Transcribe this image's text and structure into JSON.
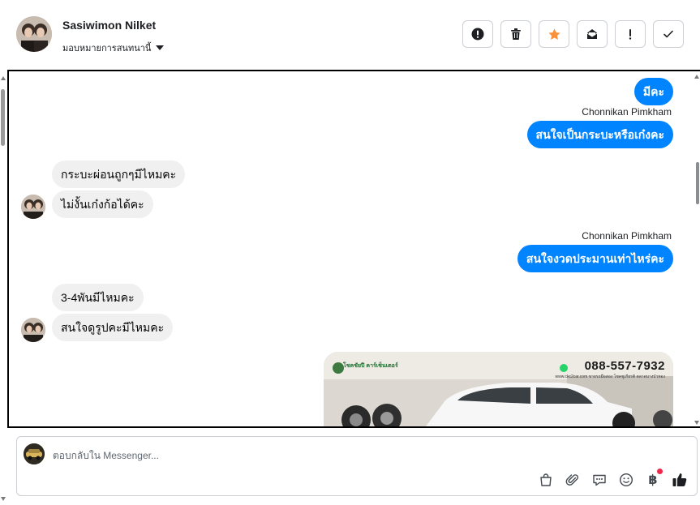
{
  "header": {
    "contact_name": "Sasiwimon Nilket",
    "assign_label": "มอบหมายการสนทนานี้",
    "actions": [
      {
        "name": "spam-button",
        "icon": "alert-circle-icon"
      },
      {
        "name": "delete-button",
        "icon": "trash-icon"
      },
      {
        "name": "star-button",
        "icon": "star-icon"
      },
      {
        "name": "mark-unread-button",
        "icon": "envelope-icon"
      },
      {
        "name": "follow-up-button",
        "icon": "exclamation-icon"
      },
      {
        "name": "done-button",
        "icon": "check-icon"
      }
    ]
  },
  "colors": {
    "outgoing": "#0084ff",
    "incoming": "#f0f0f0",
    "star": "#f7923a",
    "notification": "#f02849",
    "like": "#1c1e21"
  },
  "messages": [
    {
      "direction": "out",
      "text": "มีคะ"
    },
    {
      "direction": "out",
      "sender": "Chonnikan Pimkham",
      "text": "สนใจเป็นกระบะหรือเก๋งคะ"
    },
    {
      "direction": "in",
      "text": "กระบะผ่อนถูกๆมีไหมคะ"
    },
    {
      "direction": "in",
      "text": "ไม่งั้นเก๋งก้อได้คะ"
    },
    {
      "direction": "out",
      "sender": "Chonnikan Pimkham",
      "text": "สนใจงวดประมานเท่าไหร่คะ"
    },
    {
      "direction": "in",
      "text": "3-4พันมีไหมคะ"
    },
    {
      "direction": "in",
      "text": "สนใจดูรูปคะมีไหมคะ"
    }
  ],
  "photo": {
    "phone": "088-557-7932",
    "site": "www.ckc2car.com   ขายรถมือสอง โชคชูเกียรติ ตลาดบางบัวทอง",
    "brand": "โชคชัยปี คาร์เซ็นเตอร์"
  },
  "composer": {
    "placeholder": "ตอบกลับใน Messenger..."
  },
  "composer_tools": {
    "currency_symbol": "฿"
  }
}
